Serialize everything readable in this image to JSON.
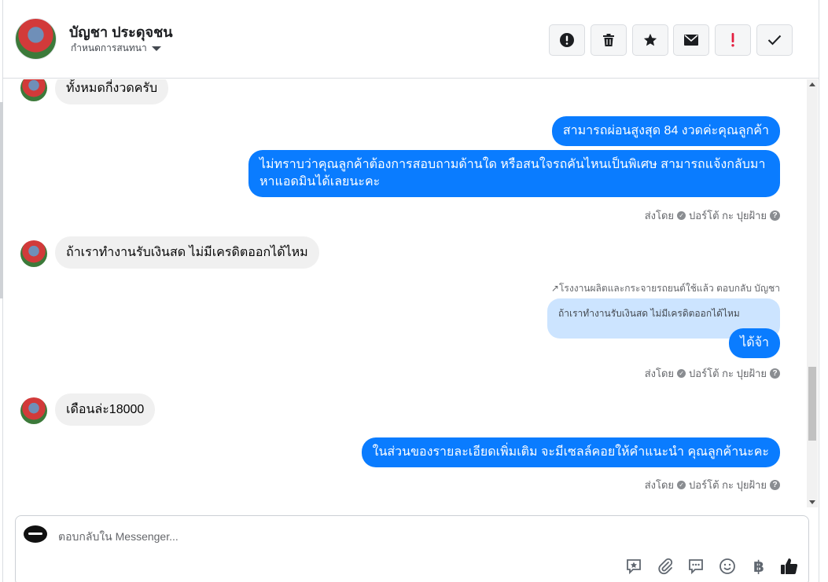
{
  "header": {
    "contact_name": "บัญชา ประดุจชน",
    "settings_label": "กำหนดการสนทนา",
    "actions": [
      {
        "name": "report-icon"
      },
      {
        "name": "trash-icon"
      },
      {
        "name": "star-icon"
      },
      {
        "name": "mail-icon"
      },
      {
        "name": "exclamation-icon"
      },
      {
        "name": "check-icon"
      }
    ]
  },
  "messages": {
    "m1": "ทั้งหมดกี่งวดครับ",
    "m2": "สามารถผ่อนสูงสุด 84 งวดค่ะคุณลูกค้า",
    "m3": "ไม่ทราบว่าคุณลูกค้าต้องการสอบถามด้านใด หรือสนใจรถคันไหนเป็นพิเศษ สามารถแจ้งกลับมาหาแอดมินได้เลยนะคะ",
    "m4": "ถ้าเราทำงานรับเงินสด  ไม่มีเครดิตออกได้ไหม",
    "reply_hint": "↗โรงงานผลิตและกระจายรถยนต์ใช้แล้ว ตอบกลับ บัญชา",
    "quoted": "ถ้าเราทำงานรับเงินสด ไม่มีเครดิตออกได้ไหม",
    "m5": "ได้จ้า",
    "m6": "เดือนล่ะ18000",
    "m7": "ในส่วนของรายละเอียดเพิ่มเติม จะมีเซลล์คอยให้คำแนะนำ คุณลูกค้านะคะ"
  },
  "sent_by": {
    "prefix": "ส่งโดย",
    "name": "ปอร์โต้ กะ ปุยฝ้าย",
    "ok_glyph": "✓",
    "help_glyph": "?"
  },
  "composer": {
    "placeholder": "ตอบกลับใน Messenger...",
    "baht_glyph": "฿"
  }
}
